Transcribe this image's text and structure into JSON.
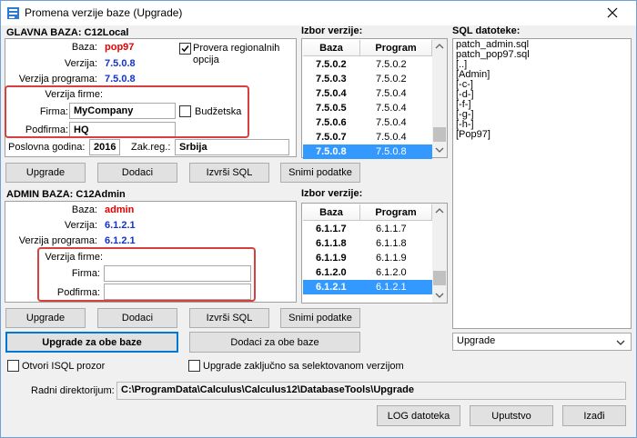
{
  "window": {
    "title": "Promena verzije baze (Upgrade)"
  },
  "main_db": {
    "header": "GLAVNA BAZA: C12Local",
    "baza_label": "Baza:",
    "baza_value": "pop97",
    "verzija_label": "Verzija:",
    "verzija_value": "7.5.0.8",
    "verzija_programa_label": "Verzija programa:",
    "verzija_programa_value": "7.5.0.8",
    "provera_label": "Provera regionalnih opcija",
    "provera_checked": true,
    "verzija_firme_label": "Verzija firme:",
    "firma_label": "Firma:",
    "firma_value": "MyCompany",
    "budzetska_label": "Budžetska",
    "podfirma_label": "Podfirma:",
    "podfirma_value": "HQ",
    "poslovna_godina_label": "Poslovna godina:",
    "poslovna_godina_value": "2016",
    "zak_reg_label": "Zak.reg.:",
    "zak_reg_value": "Srbija",
    "buttons": {
      "upgrade": "Upgrade",
      "dodaci": "Dodaci",
      "izvrsi_sql": "Izvrši SQL",
      "snimi": "Snimi podatke"
    }
  },
  "version_select_1": {
    "header": "Izbor verzije:",
    "col_baza": "Baza",
    "col_program": "Program",
    "rows": [
      {
        "baza": "7.5.0.2",
        "program": "7.5.0.2"
      },
      {
        "baza": "7.5.0.3",
        "program": "7.5.0.2"
      },
      {
        "baza": "7.5.0.4",
        "program": "7.5.0.4"
      },
      {
        "baza": "7.5.0.5",
        "program": "7.5.0.4"
      },
      {
        "baza": "7.5.0.6",
        "program": "7.5.0.4"
      },
      {
        "baza": "7.5.0.7",
        "program": "7.5.0.4"
      },
      {
        "baza": "7.5.0.8",
        "program": "7.5.0.8"
      }
    ],
    "selected_index": 6
  },
  "admin_db": {
    "header": "ADMIN BAZA: C12Admin",
    "baza_label": "Baza:",
    "baza_value": "admin",
    "verzija_label": "Verzija:",
    "verzija_value": "6.1.2.1",
    "verzija_programa_label": "Verzija programa:",
    "verzija_programa_value": "6.1.2.1",
    "verzija_firme_label": "Verzija firme:",
    "firma_label": "Firma:",
    "firma_value": "",
    "podfirma_label": "Podfirma:",
    "podfirma_value": "",
    "buttons": {
      "upgrade": "Upgrade",
      "dodaci": "Dodaci",
      "izvrsi_sql": "Izvrši SQL",
      "snimi": "Snimi podatke"
    }
  },
  "version_select_2": {
    "header": "Izbor verzije:",
    "col_baza": "Baza",
    "col_program": "Program",
    "rows": [
      {
        "baza": "6.1.1.7",
        "program": "6.1.1.7"
      },
      {
        "baza": "6.1.1.8",
        "program": "6.1.1.8"
      },
      {
        "baza": "6.1.1.9",
        "program": "6.1.1.9"
      },
      {
        "baza": "6.1.2.0",
        "program": "6.1.2.0"
      },
      {
        "baza": "6.1.2.1",
        "program": "6.1.2.1"
      }
    ],
    "selected_index": 4
  },
  "sql_files": {
    "header": "SQL datoteke:",
    "items": [
      "patch_admin.sql",
      "patch_pop97.sql",
      "[..]",
      "[Admin]",
      "[-c-]",
      "[-d-]",
      "[-f-]",
      "[-g-]",
      "[-h-]",
      "[Pop97]"
    ],
    "dropdown_value": "Upgrade"
  },
  "bottom": {
    "upgrade_both": "Upgrade za obe baze",
    "dodaci_both": "Dodaci za obe baze",
    "otvori_isql": "Otvori ISQL prozor",
    "upgrade_zakljucno": "Upgrade zaključno sa selektovanom verzijom",
    "radni_dir_label": "Radni direktorijum:",
    "radni_dir_value": "C:\\ProgramData\\Calculus\\Calculus12\\DatabaseTools\\Upgrade",
    "log_button": "LOG datoteka",
    "uputstvo_button": "Uputstvo",
    "izadji_button": "Izađi"
  },
  "colors": {
    "accent": "#3399ff",
    "red": "#e60000",
    "blue": "#1133cc",
    "highlight_box": "#d64040"
  }
}
